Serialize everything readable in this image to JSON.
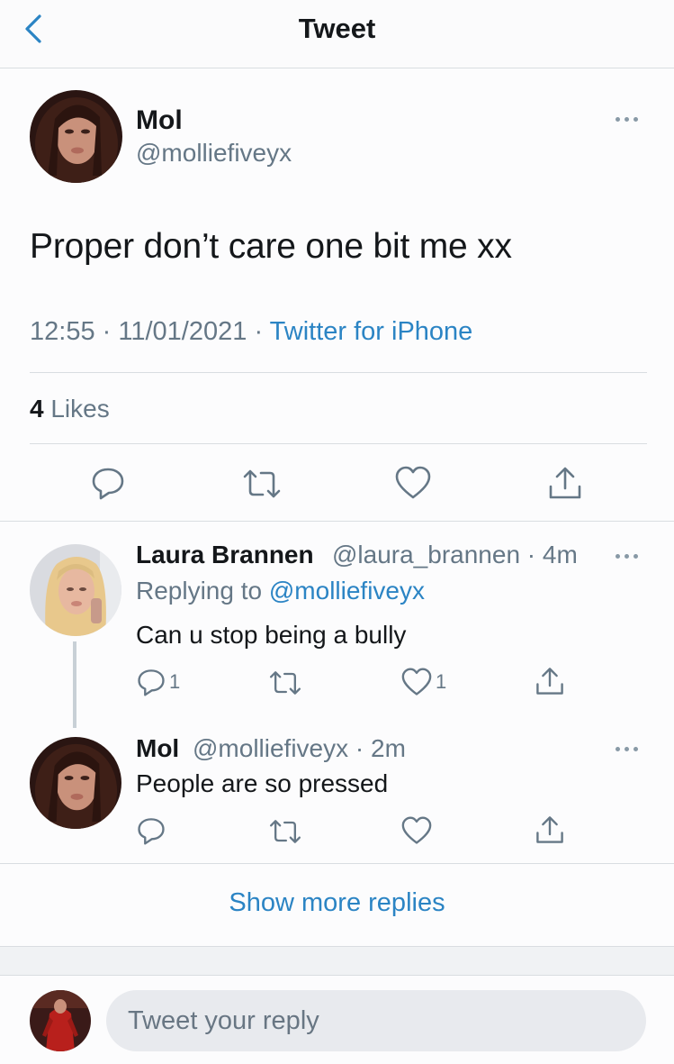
{
  "header": {
    "title": "Tweet",
    "back_icon": "chevron-left-icon"
  },
  "colors": {
    "accent": "#2b84c4",
    "text": "#14171a",
    "muted": "#657786",
    "divider": "#d9dde1"
  },
  "main_tweet": {
    "name": "Mol",
    "handle": "@molliefiveyx",
    "text": "Proper don’t care one bit me xx",
    "time": "12:55",
    "date": "11/01/2021",
    "source": "Twitter for iPhone",
    "likes_count": "4",
    "likes_label": "Likes",
    "actions": [
      "comment-icon",
      "retweet-icon",
      "heart-icon",
      "share-icon"
    ]
  },
  "replies": [
    {
      "name": "Laura Brannen",
      "handle": "@laura_brannen",
      "time": "4m",
      "replying_label": "Replying to",
      "replying_to": "@molliefiveyx",
      "text": "Can u stop being a bully",
      "comment_count": "1",
      "like_count": "1"
    },
    {
      "name": "Mol",
      "handle": "@molliefiveyx",
      "time": "2m",
      "text": "People are so pressed"
    }
  ],
  "separator": "·",
  "show_more": "Show more replies",
  "compose": {
    "placeholder": "Tweet your reply"
  }
}
